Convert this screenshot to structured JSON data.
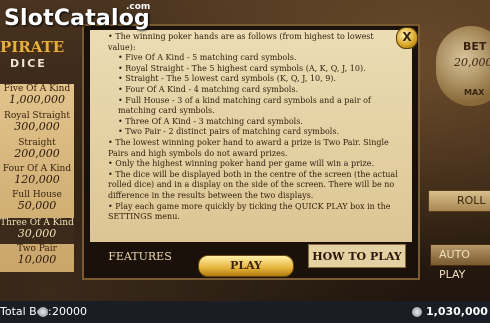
{
  "watermark": {
    "text": "SlotCatalog",
    "suffix": ".com"
  },
  "logo": {
    "line1": "PIRATE",
    "line2": "DICE"
  },
  "paytable": [
    {
      "name": "Five Of A Kind",
      "value": "1,000,000",
      "highlight": false
    },
    {
      "name": "Royal Straight",
      "value": "300,000",
      "highlight": false
    },
    {
      "name": "Straight",
      "value": "200,000",
      "highlight": false
    },
    {
      "name": "Four Of A Kind",
      "value": "120,000",
      "highlight": false
    },
    {
      "name": "Full House",
      "value": "50,000",
      "highlight": false
    },
    {
      "name": "Three Of A Kind",
      "value": "30,000",
      "highlight": true
    },
    {
      "name": "Two Pair",
      "value": "10,000",
      "highlight": false
    }
  ],
  "controls": {
    "bet_label": "BET",
    "bet_value": "20,000",
    "max_label": "MAX",
    "roll": "ROLL",
    "autoplay": "AUTO PLAY"
  },
  "dialog": {
    "close": "X",
    "rules": [
      {
        "text": "•  The winning poker hands are as follows (from highest to lowest value):",
        "indent": 0
      },
      {
        "text": "•  Five Of A Kind - 5 matching card symbols.",
        "indent": 1
      },
      {
        "text": "•  Royal Straight - The 5 highest card symbols (A, K, Q, J, 10).",
        "indent": 1
      },
      {
        "text": "•  Straight - The 5 lowest card symbols (K, Q, J, 10, 9).",
        "indent": 1
      },
      {
        "text": "•  Four Of A Kind - 4 matching card symbols.",
        "indent": 1
      },
      {
        "text": "•  Full House - 3 of a kind matching card symbols and a pair of matching card symbols.",
        "indent": 1
      },
      {
        "text": "•  Three Of A Kind - 3 matching card symbols.",
        "indent": 1
      },
      {
        "text": "•  Two Pair - 2 distinct pairs of matching card symbols.",
        "indent": 1
      },
      {
        "text": "•  The lowest winning poker hand to award a prize is Two Pair. Single Pairs and high symbols do not award prizes.",
        "indent": 0
      },
      {
        "text": "•  Only the highest winning poker hand per game will win a prize.",
        "indent": 0
      },
      {
        "text": "•  The dice will be displayed both in the centre of the screen (the actual rolled dice) and in a display on the side of the screen. There will be no difference in the results between the two displays.",
        "indent": 0
      },
      {
        "text": "•  Play each game more quickly by ticking the QUICK PLAY box in the SETTINGS menu.",
        "indent": 0
      }
    ],
    "tabs": {
      "features": "FEATURES",
      "how_to_play": "HOW TO PLAY"
    },
    "play": "PLAY"
  },
  "bottombar": {
    "bet_label": "Total Bet:",
    "bet_value": "20000",
    "balance": "1,030,000"
  }
}
